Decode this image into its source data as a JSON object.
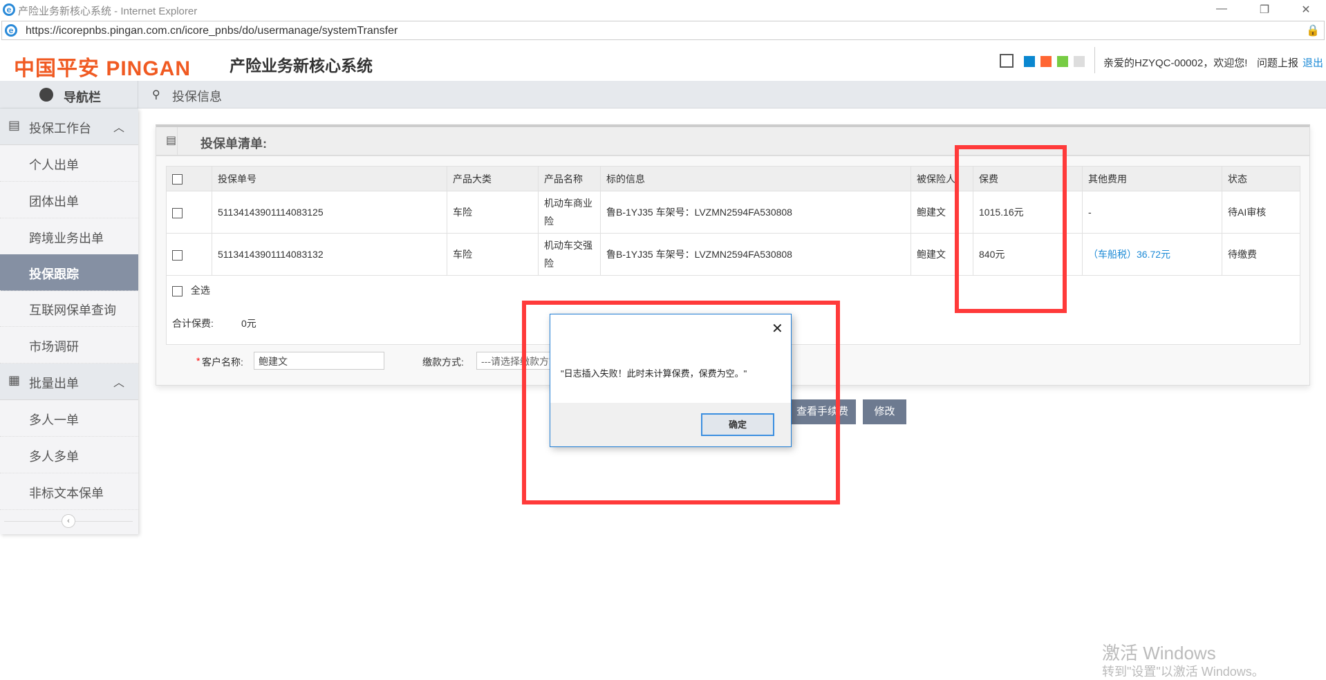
{
  "browser": {
    "title": "产险业务新核心系统 - Internet Explorer",
    "url": "https://icorepnbs.pingan.com.cn/icore_pnbs/do/usermanage/systemTransfer"
  },
  "header": {
    "logo": "中国平安 PINGAN",
    "system_name": "产险业务新核心系统",
    "theme_colors": [
      "#0a87d0",
      "#ff6633",
      "#77cc44",
      "#dddddd"
    ],
    "welcome": "亲爱的HZYQC-00002，欢迎您!",
    "report": "问题上报",
    "logout": "退出"
  },
  "nav": {
    "title": "导航栏",
    "breadcrumb": "投保信息"
  },
  "sidebar": {
    "groups": [
      {
        "label": "投保工作台",
        "items": [
          "个人出单",
          "团体出单",
          "跨境业务出单",
          "投保跟踪",
          "互联网保单查询",
          "市场调研"
        ]
      },
      {
        "label": "批量出单",
        "items": [
          "多人一单",
          "多人多单",
          "非标文本保单"
        ]
      }
    ],
    "active": "投保跟踪"
  },
  "panel": {
    "title": "投保单清单:",
    "columns": [
      "投保单号",
      "产品大类",
      "产品名称",
      "标的信息",
      "被保险人",
      "保费",
      "其他费用",
      "状态"
    ],
    "rows": [
      {
        "no": "51134143901114083125",
        "category": "车险",
        "product": "机动车商业险",
        "subject": "鲁B-1YJ35 车架号：LVZMN2594FA530808",
        "insured": "鲍建文",
        "premium": "1015.16元",
        "other": "-",
        "status": "待AI审核"
      },
      {
        "no": "51134143901114083132",
        "category": "车险",
        "product": "机动车交强险",
        "subject": "鲁B-1YJ35 车架号：LVZMN2594FA530808",
        "insured": "鲍建文",
        "premium": "840元",
        "other": "（车船税）36.72元",
        "status": "待缴费"
      }
    ],
    "select_all": "全选",
    "total_label": "合计保费:",
    "total_value": "0元",
    "customer_label": "客户名称:",
    "customer_required": "*",
    "customer_value": "鲍建文",
    "payment_label": "缴款方式:",
    "payment_placeholder": "---请选择缴款方式---"
  },
  "buttons": {
    "fee": "查看手续费",
    "modify": "修改"
  },
  "dialog": {
    "message": "\"日志插入失败！此时未计算保费，保费为空。\"",
    "ok": "确定"
  },
  "watermark": {
    "line1": "激活 Windows",
    "line2": "转到\"设置\"以激活 Windows。"
  }
}
